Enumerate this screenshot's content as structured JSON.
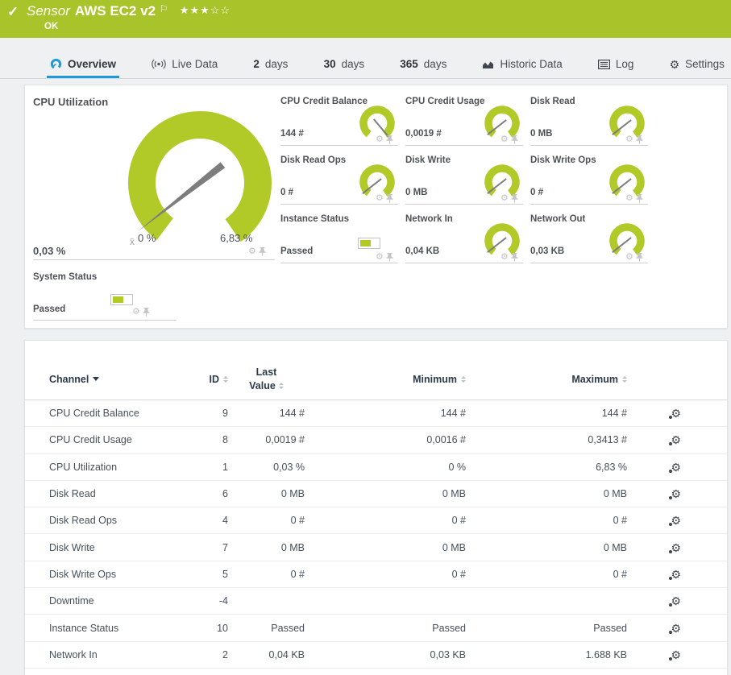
{
  "header": {
    "status_icon": "check",
    "sensor_label": "Sensor",
    "sensor_name": "AWS EC2 v2",
    "stars_filled": "★★★",
    "stars_empty": "☆☆",
    "status": "OK"
  },
  "tabs": [
    {
      "label": "Overview",
      "icon": "gauge",
      "active": true
    },
    {
      "label": "Live Data",
      "icon": "live",
      "active": false
    },
    {
      "num": "2",
      "label": "days",
      "active": false
    },
    {
      "num": "30",
      "label": "days",
      "active": false
    },
    {
      "num": "365",
      "label": "days",
      "active": false
    },
    {
      "label": "Historic Data",
      "icon": "chart",
      "active": false
    },
    {
      "label": "Log",
      "icon": "log",
      "active": false
    },
    {
      "label": "Settings",
      "icon": "gear",
      "active": false
    }
  ],
  "gauges": {
    "main": {
      "title": "CPU Utilization",
      "value": "0,03 %",
      "min_label": "0 %",
      "max_label": "6,83 %",
      "avg_marker": "x̄"
    },
    "cells": [
      {
        "title": "CPU Credit Balance",
        "value": "144 #",
        "widget": "gauge",
        "needle": "high"
      },
      {
        "title": "CPU Credit Usage",
        "value": "0,0019 #",
        "widget": "gauge",
        "needle": "low"
      },
      {
        "title": "Disk Read",
        "value": "0 MB",
        "widget": "gauge",
        "needle": "low"
      },
      {
        "title": "Disk Read Ops",
        "value": "0 #",
        "widget": "gauge",
        "needle": "low"
      },
      {
        "title": "Disk Write",
        "value": "0 MB",
        "widget": "gauge",
        "needle": "low"
      },
      {
        "title": "Disk Write Ops",
        "value": "0 #",
        "widget": "gauge",
        "needle": "low"
      },
      {
        "title": "Instance Status",
        "value": "Passed",
        "widget": "status"
      },
      {
        "title": "Network In",
        "value": "0,04 KB",
        "widget": "gauge",
        "needle": "low"
      },
      {
        "title": "Network Out",
        "value": "0,03 KB",
        "widget": "gauge",
        "needle": "low"
      }
    ],
    "system_status": {
      "title": "System Status",
      "value": "Passed",
      "widget": "status"
    }
  },
  "table": {
    "columns": {
      "channel": "Channel",
      "id": "ID",
      "last1": "Last",
      "last2": "Value",
      "min": "Minimum",
      "max": "Maximum"
    },
    "rows": [
      [
        "CPU Credit Balance",
        "9",
        "144 #",
        "144 #",
        "144 #"
      ],
      [
        "CPU Credit Usage",
        "8",
        "0,0019 #",
        "0,0016 #",
        "0,3413 #"
      ],
      [
        "CPU Utilization",
        "1",
        "0,03 %",
        "0 %",
        "6,83 %"
      ],
      [
        "Disk Read",
        "6",
        "0 MB",
        "0 MB",
        "0 MB"
      ],
      [
        "Disk Read Ops",
        "4",
        "0 #",
        "0 #",
        "0 #"
      ],
      [
        "Disk Write",
        "7",
        "0 MB",
        "0 MB",
        "0 MB"
      ],
      [
        "Disk Write Ops",
        "5",
        "0 #",
        "0 #",
        "0 #"
      ],
      [
        "Downtime",
        "-4",
        "",
        "",
        ""
      ],
      [
        "Instance Status",
        "10",
        "Passed",
        "Passed",
        "Passed"
      ],
      [
        "Network In",
        "2",
        "0,04 KB",
        "0,03 KB",
        "1.688 KB"
      ]
    ]
  },
  "colors": {
    "banner_green": "#a9c32a",
    "gauge_green": "#b2ca28",
    "active_tab_blue": "#1d9bd8",
    "needle_gray": "#7d7d7d"
  }
}
